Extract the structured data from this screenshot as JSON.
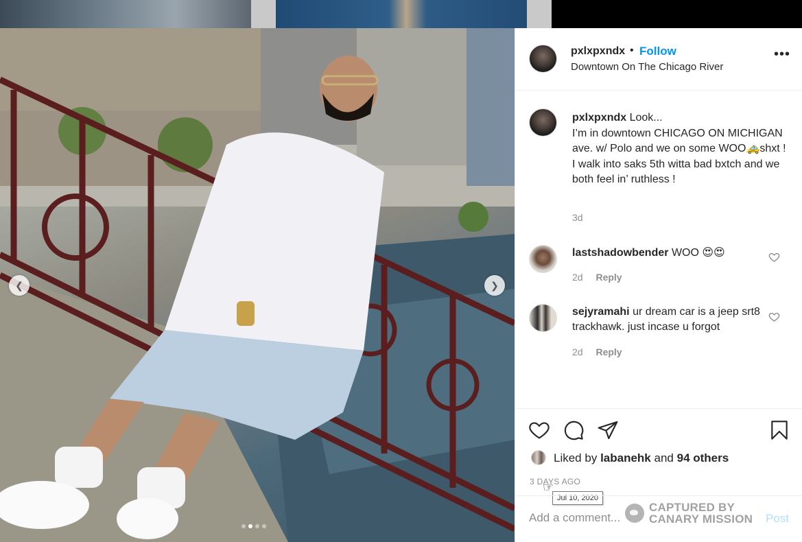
{
  "post": {
    "username": "pxlxpxndx",
    "follow_label": "Follow",
    "separator": "•",
    "location": "Downtown On The Chicago River",
    "more_label": "•••"
  },
  "caption": {
    "username": "pxlxpxndx",
    "lines": [
      "Look...",
      "I’m in downtown CHICAGO ON MICHIGAN ave. w/ Polo and we on some WOO🚕shxt !",
      "I walk into saks 5th witta bad bxtch and we both feel in’ ruthless !"
    ],
    "time": "3d"
  },
  "comments": [
    {
      "username": "lastshadowbender",
      "text": "WOO 😍😍",
      "time": "2d",
      "reply_label": "Reply"
    },
    {
      "username": "sejyramahi",
      "text": "ur dream car is a jeep srt8 trackhawk. just incase u forgot",
      "time": "2d",
      "reply_label": "Reply"
    }
  ],
  "likes": {
    "prefix": "Liked by",
    "user": "labanehk",
    "and": "and",
    "others": "94 others"
  },
  "timestamp": "3 DAYS AGO",
  "tooltip": "Jul 10, 2020",
  "add_comment": {
    "placeholder": "Add a comment...",
    "post_label": "Post"
  },
  "watermark": {
    "line1": "CAPTURED BY",
    "line2": "CANARY MISSION"
  },
  "carousel": {
    "prev_icon": "chevron-left-icon",
    "next_icon": "chevron-right-icon",
    "slides": 4,
    "active_slide": 2
  },
  "colors": {
    "follow": "#0095f6",
    "post_disabled": "#b2dffc",
    "muted": "#8e8e8e",
    "text": "#262626"
  }
}
